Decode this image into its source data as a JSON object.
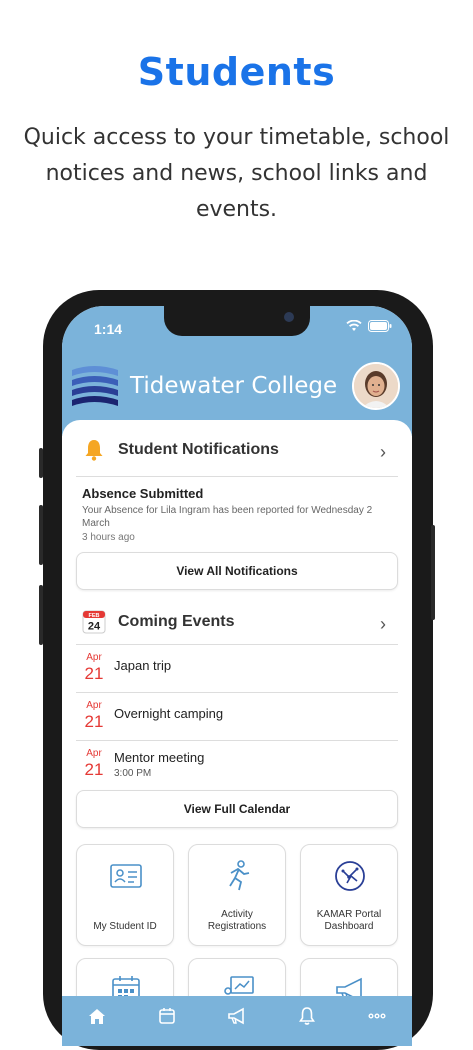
{
  "promo": {
    "headline": "Students",
    "subline": "Quick access to your timetable, school notices and news, school links and events."
  },
  "status_bar": {
    "time": "1:14"
  },
  "header": {
    "school_name": "Tidewater College",
    "brand_color": "#7bb3da"
  },
  "notifications": {
    "title": "Student Notifications",
    "item": {
      "title": "Absence Submitted",
      "body": "Your Absence for Lila Ingram has been reported for Wednesday 2 March",
      "time": "3 hours ago"
    },
    "view_all_label": "View All Notifications"
  },
  "events": {
    "title": "Coming Events",
    "calendar_icon": {
      "month": "FEB",
      "day": "24"
    },
    "items": [
      {
        "month": "Apr",
        "day": "21",
        "title": "Japan trip",
        "sub": ""
      },
      {
        "month": "Apr",
        "day": "21",
        "title": "Overnight camping",
        "sub": ""
      },
      {
        "month": "Apr",
        "day": "21",
        "title": "Mentor meeting",
        "sub": "3:00 PM"
      }
    ],
    "view_calendar_label": "View Full Calendar"
  },
  "tiles": [
    {
      "label": "My Student ID",
      "icon": "id-card-icon"
    },
    {
      "label": "Activity Registrations",
      "icon": "running-icon"
    },
    {
      "label": "KAMAR Portal Dashboard",
      "icon": "kamar-icon"
    },
    {
      "label": "",
      "icon": "calendar-icon"
    },
    {
      "label": "",
      "icon": "presentation-icon"
    },
    {
      "label": "",
      "icon": "megaphone-icon"
    }
  ],
  "tabbar": [
    {
      "icon": "home-icon"
    },
    {
      "icon": "calendar-icon"
    },
    {
      "icon": "megaphone-icon"
    },
    {
      "icon": "bell-icon"
    },
    {
      "icon": "more-icon"
    }
  ],
  "colors": {
    "accent": "#1a73e8",
    "event_date": "#e53935",
    "bell": "#f5a623"
  }
}
